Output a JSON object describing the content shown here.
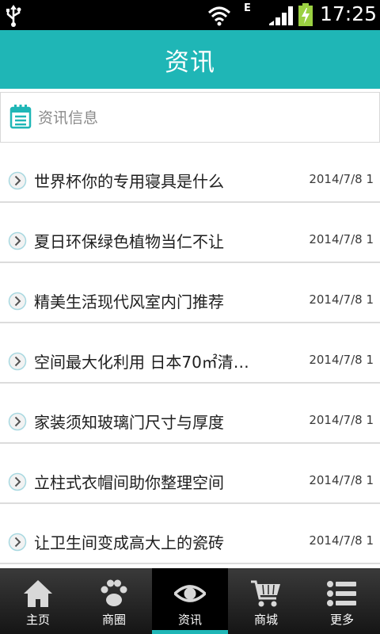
{
  "status_bar": {
    "network": "E",
    "time": "17:25"
  },
  "header": {
    "title": "资讯"
  },
  "section": {
    "title": "资讯信息",
    "icon": "notepad-icon"
  },
  "news_items": [
    {
      "title": "世界杯你的专用寝具是什么",
      "date": "2014/7/8 1"
    },
    {
      "title": "夏日环保绿色植物当仁不让",
      "date": "2014/7/8 1"
    },
    {
      "title": "精美生活现代风室内门推荐",
      "date": "2014/7/8 1"
    },
    {
      "title": "空间最大化利用 日本70㎡清…",
      "date": "2014/7/8 1"
    },
    {
      "title": "家装须知玻璃门尺寸与厚度",
      "date": "2014/7/8 1"
    },
    {
      "title": "立柱式衣帽间助你整理空间",
      "date": "2014/7/8 1"
    },
    {
      "title": "让卫生间变成高大上的瓷砖",
      "date": "2014/7/8 1"
    }
  ],
  "tabs": [
    {
      "label": "主页",
      "icon": "home-icon"
    },
    {
      "label": "商圈",
      "icon": "paw-icon"
    },
    {
      "label": "资讯",
      "icon": "eye-icon",
      "active": true
    },
    {
      "label": "商城",
      "icon": "cart-icon"
    },
    {
      "label": "更多",
      "icon": "list-icon"
    }
  ],
  "colors": {
    "accent": "#1fb6b6",
    "status_bar": "#000000",
    "tab_bar": "#2a2a2a"
  }
}
